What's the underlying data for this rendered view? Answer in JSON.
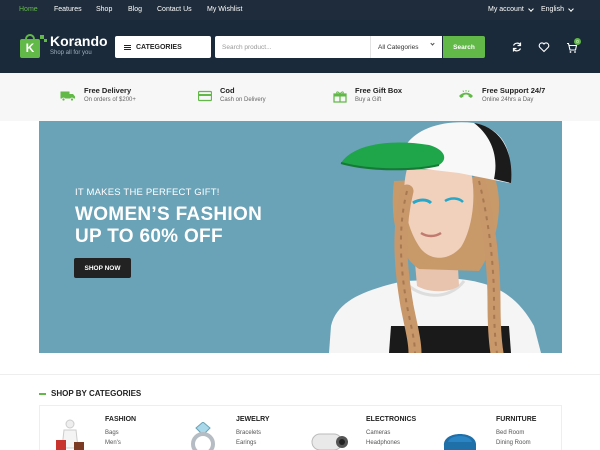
{
  "topbar": {
    "nav": [
      "Home",
      "Features",
      "Shop",
      "Blog",
      "Contact Us",
      "My Wishlist"
    ],
    "account": "My account",
    "language": "English"
  },
  "header": {
    "logo_letter": "K",
    "logo_name": "Korando",
    "logo_tagline": "Shop all for you",
    "categories_label": "CATEGORIES",
    "search_placeholder": "Search product...",
    "category_select": "All Categories",
    "search_button": "Search",
    "cart_count": "0",
    "icons": [
      "refresh-icon",
      "heart-icon",
      "cart-icon"
    ]
  },
  "features": [
    {
      "title": "Free Delivery",
      "subtitle": "On orders of $200+",
      "icon": "truck-icon"
    },
    {
      "title": "Cod",
      "subtitle": "Cash on Delivery",
      "icon": "credit-card-icon"
    },
    {
      "title": "Free Gift Box",
      "subtitle": "Buy a Gift",
      "icon": "gift-icon"
    },
    {
      "title": "Free Support 24/7",
      "subtitle": "Online 24hrs a Day",
      "icon": "phone-icon"
    }
  ],
  "hero": {
    "subtitle": "IT MAKES THE PERFECT GIFT!",
    "title_line1": "WOMEN’S FASHION",
    "title_line2": "UP TO 60% OFF",
    "button": "SHOP NOW",
    "colors": {
      "background": "#6aa3b7",
      "cap": "#1fa54a"
    }
  },
  "shop_by_categories": {
    "title": "SHOP BY CATEGORIES",
    "categories": [
      {
        "title": "FASHION",
        "links": [
          "Bags",
          "Men's"
        ]
      },
      {
        "title": "JEWELRY",
        "links": [
          "Bracelets",
          "Earings"
        ]
      },
      {
        "title": "ELECTRONICS",
        "links": [
          "Cameras",
          "Headphones"
        ]
      },
      {
        "title": "FURNITURE",
        "links": [
          "Bed Room",
          "Dining Room"
        ]
      }
    ]
  },
  "colors": {
    "accent": "#62b948",
    "dark": "#1a2a3a"
  }
}
